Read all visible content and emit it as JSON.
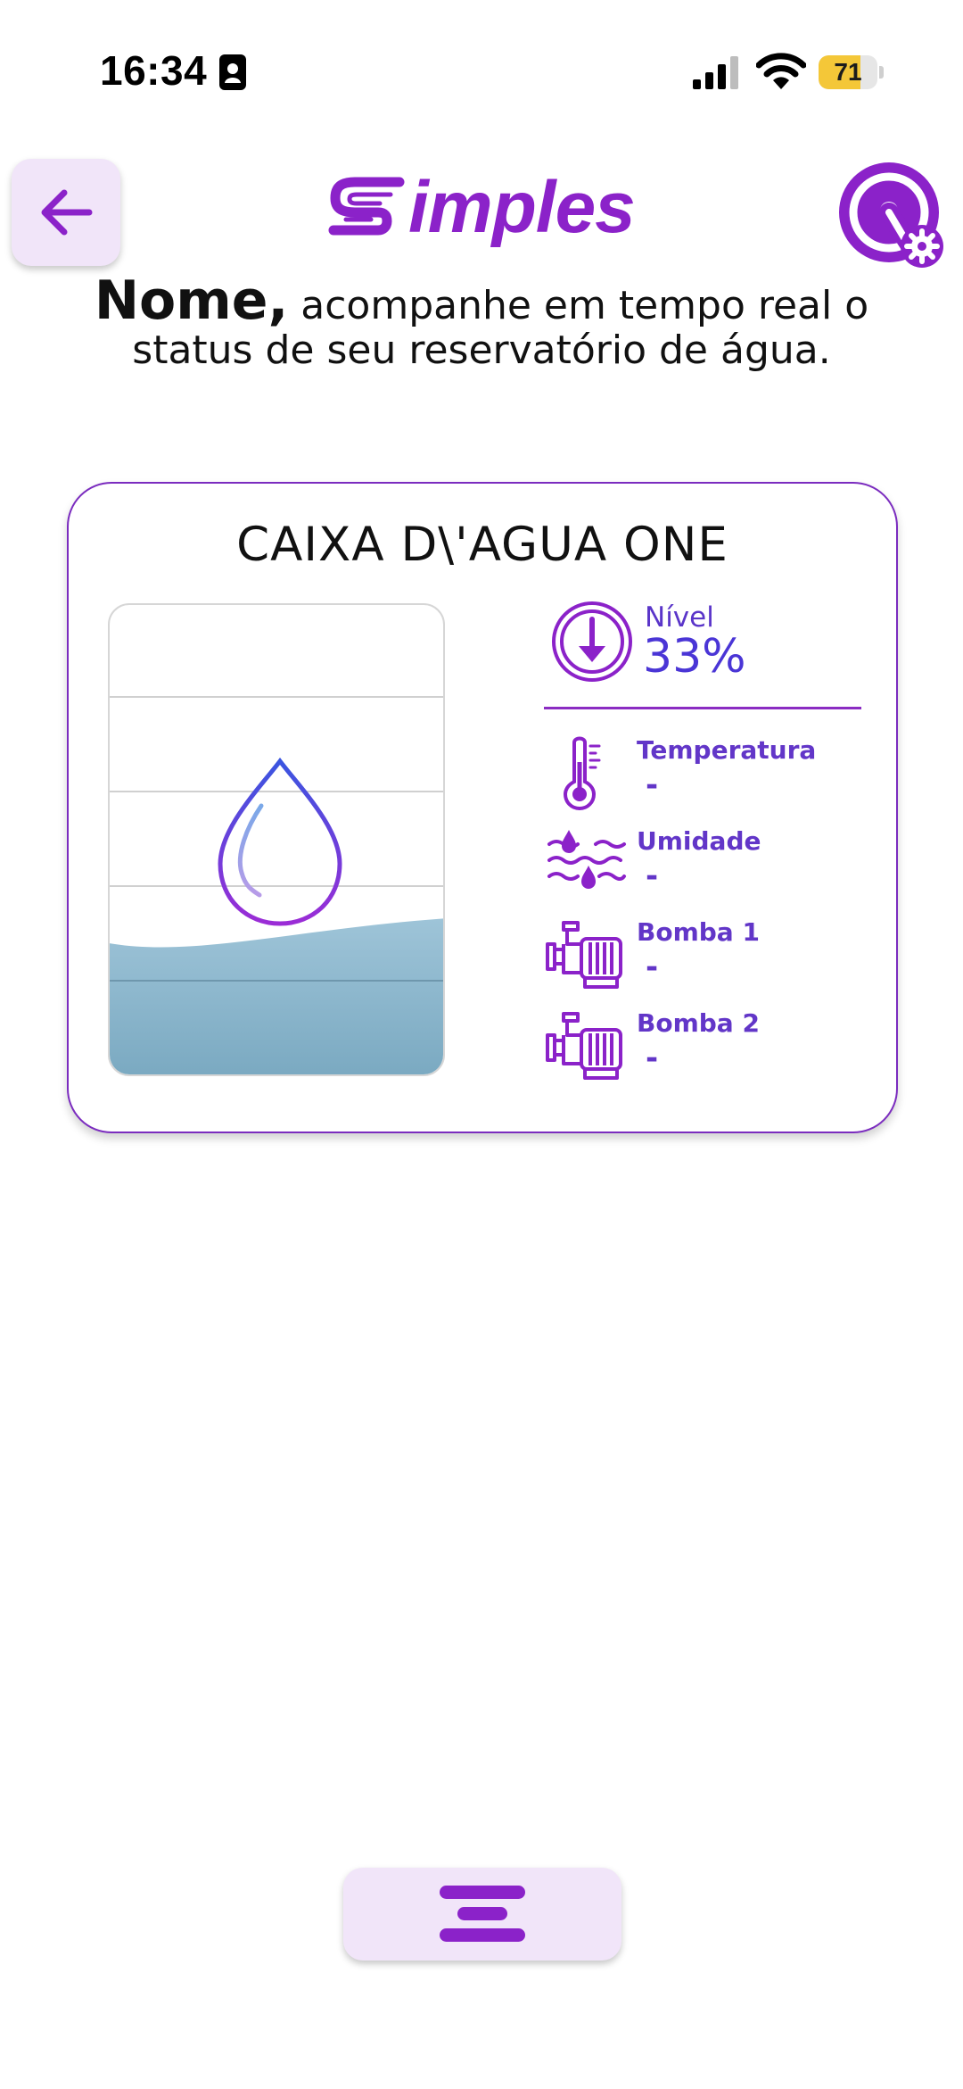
{
  "status_bar": {
    "time": "16:34",
    "battery_percent": "71",
    "battery_level": 0.71,
    "battery_color": "#f4c738"
  },
  "header": {
    "back_icon": "arrow-left-icon",
    "logo_text": "imples",
    "settings_icon": "gear-icon",
    "accent_color": "#8b22c9"
  },
  "greeting": {
    "name": "Nome,",
    "message": " acompanhe em tempo real o status de seu reservatório de água."
  },
  "reservoir": {
    "title": "CAIXA D\\'AGUA ONE",
    "level_fraction": 0.33,
    "water_color": "#8eb7cd",
    "metrics": {
      "nivel": {
        "label": "Nível",
        "value": "33%",
        "icon": "arrow-down-circle-icon"
      },
      "temperatura": {
        "label": "Temperatura",
        "value": "-",
        "icon": "thermometer-icon"
      },
      "umidade": {
        "label": "Umidade",
        "value": "-",
        "icon": "humidity-icon"
      },
      "bomba1": {
        "label": "Bomba 1",
        "value": "-",
        "icon": "pump-icon"
      },
      "bomba2": {
        "label": "Bomba 2",
        "value": "-",
        "icon": "pump-icon"
      }
    }
  },
  "bottom_nav": {
    "menu_icon": "menu-icon"
  }
}
